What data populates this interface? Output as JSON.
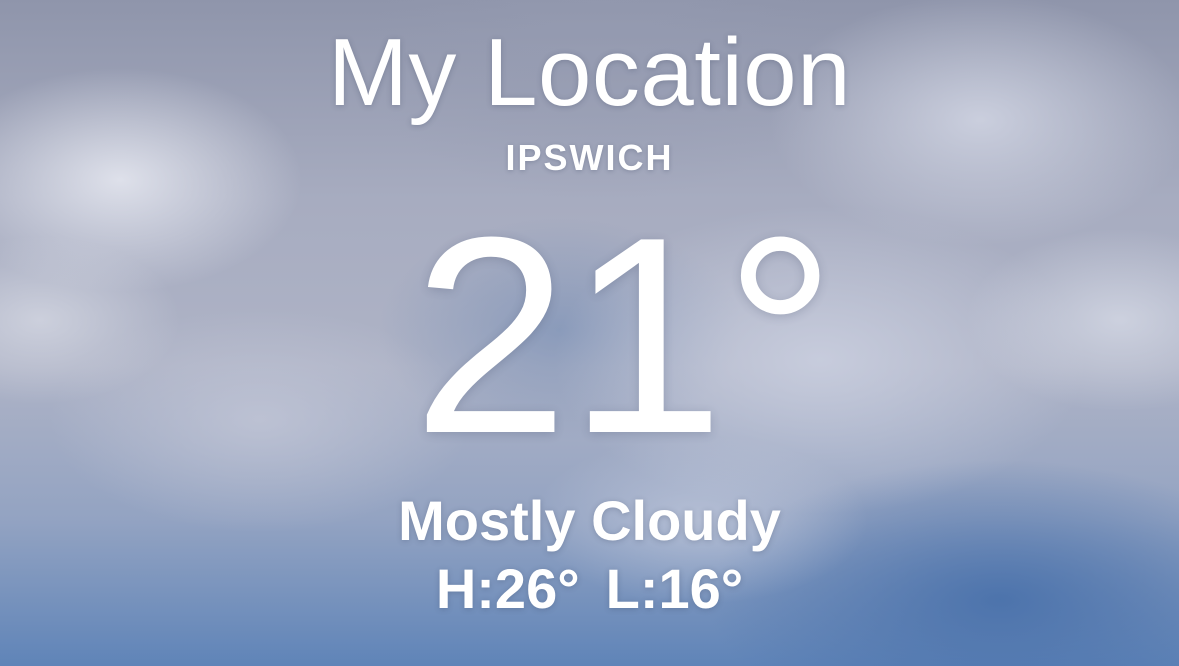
{
  "location": {
    "title": "My Location",
    "subtitle": "IPSWICH"
  },
  "current": {
    "temperature": "21°",
    "condition": "Mostly Cloudy",
    "high": "H:26°",
    "low": "L:16°"
  },
  "colors": {
    "text": "#ffffff",
    "sky_top": "#8f95ab",
    "sky_bottom": "#5f84b8"
  }
}
